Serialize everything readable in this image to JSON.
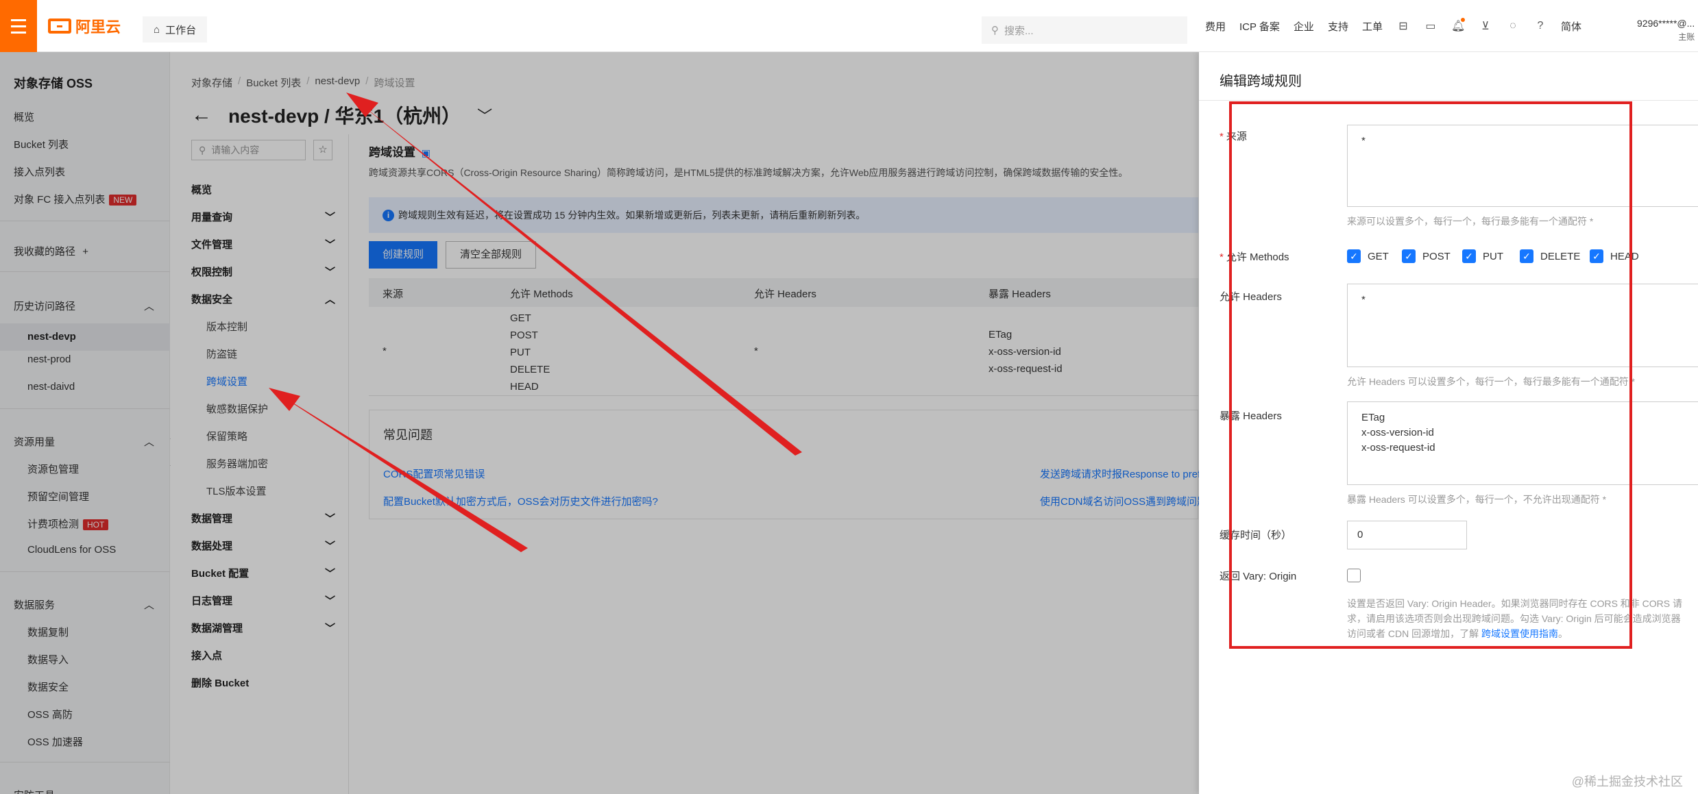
{
  "header": {
    "logo_text": "阿里云",
    "workbench": "工作台",
    "search_placeholder": "搜索...",
    "nav": [
      "费用",
      "ICP 备案",
      "企业",
      "支持",
      "工单"
    ],
    "lang": "简体",
    "account": "9296*****@...",
    "account_role": "主账"
  },
  "sidebar": {
    "title": "对象存储 OSS",
    "items": [
      "概览",
      "Bucket 列表",
      "接入点列表",
      "对象 FC 接入点列表"
    ],
    "new_badge": "NEW",
    "favorites": "我收藏的路径",
    "history": {
      "title": "历史访问路径",
      "items": [
        "nest-devp",
        "nest-prod",
        "nest-daivd"
      ]
    },
    "resources": {
      "title": "资源用量",
      "items": [
        "资源包管理",
        "预留空间管理",
        "计费项检测",
        "CloudLens for OSS"
      ]
    },
    "hot_badge": "HOT",
    "data_services": {
      "title": "数据服务",
      "items": [
        "数据复制",
        "数据导入",
        "数据安全",
        "OSS 高防",
        "OSS 加速器"
      ]
    },
    "more": "安防工具"
  },
  "breadcrumb": [
    "对象存储",
    "Bucket 列表",
    "nest-devp",
    "跨域设置"
  ],
  "page_title": "nest-devp / 华东1（杭州）",
  "secondary_nav": {
    "search_placeholder": "请输入内容",
    "items": [
      {
        "label": "概览"
      },
      {
        "label": "用量查询",
        "expand": true
      },
      {
        "label": "文件管理",
        "expand": true
      },
      {
        "label": "权限控制",
        "expand": true
      },
      {
        "label": "数据安全",
        "expand": true,
        "open": true,
        "children": [
          "版本控制",
          "防盗链",
          "跨域设置",
          "敏感数据保护",
          "保留策略",
          "服务器端加密",
          "TLS版本设置"
        ]
      },
      {
        "label": "数据管理",
        "expand": true
      },
      {
        "label": "数据处理",
        "expand": true
      },
      {
        "label": "Bucket 配置",
        "expand": true
      },
      {
        "label": "日志管理",
        "expand": true
      },
      {
        "label": "数据湖管理",
        "expand": true
      },
      {
        "label": "接入点"
      },
      {
        "label": "删除 Bucket"
      }
    ],
    "selected": "跨域设置"
  },
  "content": {
    "title": "跨域设置",
    "description": "跨域资源共享CORS（Cross-Origin Resource Sharing）简称跨域访问，是HTML5提供的标准跨域解决方案，允许Web应用服务器进行跨域访问控制，确保跨域数据传输的安全性。",
    "notice": "跨域规则生效有延迟，将在设置成功 15 分钟内生效。如果新增或更新后，列表未更新，请稍后重新刷新列表。",
    "create_button": "创建规则",
    "clear_button": "清空全部规则",
    "table": {
      "headers": [
        "来源",
        "允许 Methods",
        "允许 Headers",
        "暴露 Headers"
      ],
      "row": {
        "origin": "*",
        "methods": [
          "GET",
          "POST",
          "PUT",
          "DELETE",
          "HEAD"
        ],
        "headers": "*",
        "expose": [
          "ETag",
          "x-oss-version-id",
          "x-oss-request-id"
        ]
      }
    },
    "faq": {
      "title": "常见问题",
      "links": [
        "CORS配置项常见错误",
        "发送跨域请求时报Response to pref",
        "配置Bucket默认加密方式后，OSS会对历史文件进行加密吗?",
        "使用CDN域名访问OSS遇到跨域问题"
      ]
    }
  },
  "drawer": {
    "title": "编辑跨域规则",
    "origin_label": "来源",
    "origin_value": "*",
    "origin_help": "来源可以设置多个，每行一个，每行最多能有一个通配符 *",
    "methods_label": "允许 Methods",
    "methods": [
      "GET",
      "POST",
      "PUT",
      "DELETE",
      "HEAD"
    ],
    "allow_headers_label": "允许 Headers",
    "allow_headers_value": "*",
    "allow_headers_help": "允许 Headers 可以设置多个，每行一个，每行最多能有一个通配符 *",
    "expose_label": "暴露 Headers",
    "expose_value": "ETag\nx-oss-version-id\nx-oss-request-id",
    "expose_help": "暴露 Headers 可以设置多个，每行一个，不允许出现通配符 *",
    "cache_label": "缓存时间（秒）",
    "cache_value": "0",
    "vary_label": "返回 Vary: Origin",
    "vary_help_1": "设置是否返回 Vary: Origin Header。如果浏览器同时存在 CORS 和非 CORS 请",
    "vary_help_2": "求，请启用该选项否则会出现跨域问题。勾选 Vary: Origin 后可能会造成浏览器",
    "vary_help_3": "访问或者 CDN 回源增加，了解",
    "vary_help_link": "跨域设置使用指南",
    "vary_help_end": "。"
  },
  "watermark": "@稀土掘金技术社区",
  "colors": {
    "brand": "#ff6a00",
    "primary": "#1677ff",
    "annotation": "#e02020"
  }
}
